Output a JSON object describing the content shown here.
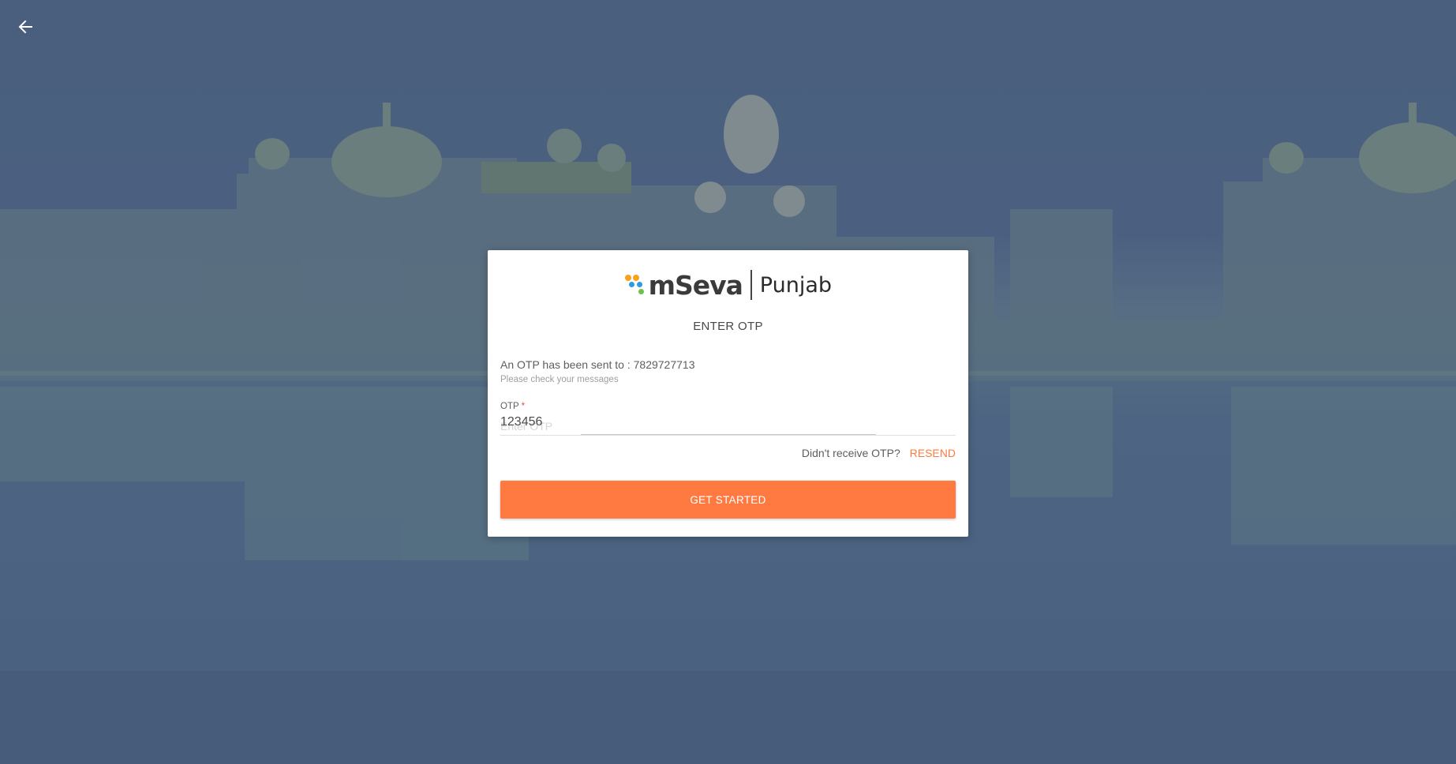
{
  "colors": {
    "accent": "#fe7a41",
    "overlay": "#4a5f7c",
    "dot_orange": "#f7a21b",
    "dot_blue": "#2e9be0",
    "dot_green": "#6cc24a"
  },
  "nav": {
    "back_icon": "arrow-left-icon"
  },
  "logo": {
    "word": "mSeva",
    "sub": "Punjab"
  },
  "form": {
    "heading": "ENTER OTP",
    "sent_prefix": "An OTP has been sent to :",
    "phone": "7829727713",
    "hint": "Please check your messages",
    "otp_label": "OTP",
    "otp_required_mark": "*",
    "otp_value": "123456",
    "otp_placeholder": "Enter OTP",
    "resend_prompt": "Didn't receive OTP?",
    "resend_label": "RESEND",
    "submit_label": "GET STARTED"
  }
}
